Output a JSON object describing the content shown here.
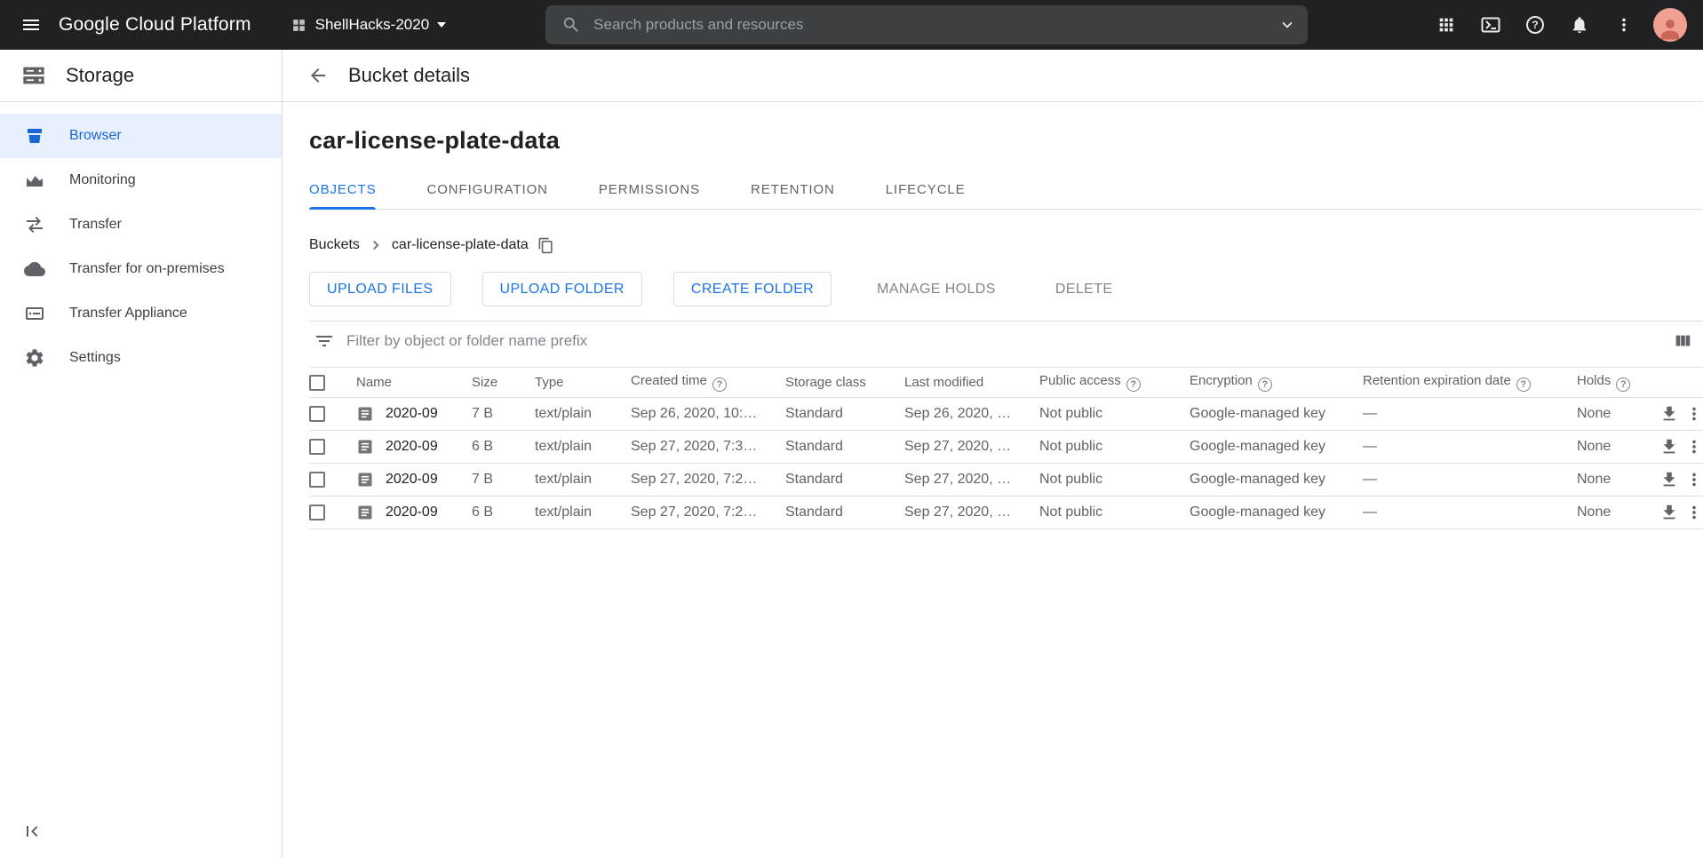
{
  "topbar": {
    "product_name": "Google Cloud Platform",
    "project_selector": {
      "label": "ShellHacks-2020"
    },
    "search": {
      "placeholder": "Search products and resources"
    }
  },
  "sidebar": {
    "product_title": "Storage",
    "items": [
      {
        "label": "Browser",
        "active": true
      },
      {
        "label": "Monitoring",
        "active": false
      },
      {
        "label": "Transfer",
        "active": false
      },
      {
        "label": "Transfer for on-premises",
        "active": false
      },
      {
        "label": "Transfer Appliance",
        "active": false
      },
      {
        "label": "Settings",
        "active": false
      }
    ]
  },
  "main": {
    "header_title": "Bucket details",
    "bucket_title": "car-license-plate-data",
    "tabs": [
      {
        "label": "OBJECTS",
        "active": true
      },
      {
        "label": "CONFIGURATION",
        "active": false
      },
      {
        "label": "PERMISSIONS",
        "active": false
      },
      {
        "label": "RETENTION",
        "active": false
      },
      {
        "label": "LIFECYCLE",
        "active": false
      }
    ],
    "breadcrumb": {
      "parent": "Buckets",
      "current": "car-license-plate-data"
    },
    "actions": {
      "upload_files": "UPLOAD FILES",
      "upload_folder": "UPLOAD FOLDER",
      "create_folder": "CREATE FOLDER",
      "manage_holds": "MANAGE HOLDS",
      "delete": "DELETE"
    },
    "filter": {
      "placeholder": "Filter by object or folder name prefix"
    },
    "table": {
      "columns": [
        {
          "label": "Name",
          "help": false
        },
        {
          "label": "Size",
          "help": false
        },
        {
          "label": "Type",
          "help": false
        },
        {
          "label": "Created time",
          "help": true
        },
        {
          "label": "Storage class",
          "help": false
        },
        {
          "label": "Last modified",
          "help": false
        },
        {
          "label": "Public access",
          "help": true
        },
        {
          "label": "Encryption",
          "help": true
        },
        {
          "label": "Retention expiration date",
          "help": true
        },
        {
          "label": "Holds",
          "help": true
        }
      ],
      "rows": [
        {
          "name": "2020-09",
          "size": "7 B",
          "type": "text/plain",
          "created": "Sep 26, 2020, 10:…",
          "storage_class": "Standard",
          "last_modified": "Sep 26, 2020, …",
          "public_access": "Not public",
          "encryption": "Google-managed key",
          "retention_expiration": "—",
          "holds": "None"
        },
        {
          "name": "2020-09",
          "size": "6 B",
          "type": "text/plain",
          "created": "Sep 27, 2020, 7:3…",
          "storage_class": "Standard",
          "last_modified": "Sep 27, 2020, …",
          "public_access": "Not public",
          "encryption": "Google-managed key",
          "retention_expiration": "—",
          "holds": "None"
        },
        {
          "name": "2020-09",
          "size": "7 B",
          "type": "text/plain",
          "created": "Sep 27, 2020, 7:2…",
          "storage_class": "Standard",
          "last_modified": "Sep 27, 2020, …",
          "public_access": "Not public",
          "encryption": "Google-managed key",
          "retention_expiration": "—",
          "holds": "None"
        },
        {
          "name": "2020-09",
          "size": "6 B",
          "type": "text/plain",
          "created": "Sep 27, 2020, 7:2…",
          "storage_class": "Standard",
          "last_modified": "Sep 27, 2020, …",
          "public_access": "Not public",
          "encryption": "Google-managed key",
          "retention_expiration": "—",
          "holds": "None"
        }
      ]
    }
  },
  "colors": {
    "topbar_bg": "#212124",
    "accent_blue": "#1a73e8",
    "active_nav_text": "#1967d2",
    "active_nav_bg": "#e8f0fe",
    "secondary_text": "#5f6368"
  },
  "icons": {
    "topbar": [
      "menu",
      "search",
      "chevron-down",
      "apps-grid",
      "cloud-shell",
      "help",
      "notifications",
      "more-vertical",
      "avatar"
    ],
    "sidebar": [
      "storage-product",
      "bucket-browser",
      "monitoring-chart",
      "transfer-arrows",
      "cloud-upload",
      "transfer-appliance",
      "settings-gear",
      "collapse-first-page"
    ],
    "content": [
      "back-arrow",
      "breadcrumb-chevron",
      "content-copy",
      "filter-list",
      "view-columns",
      "help-circle",
      "file-document",
      "download",
      "more-vertical"
    ]
  }
}
